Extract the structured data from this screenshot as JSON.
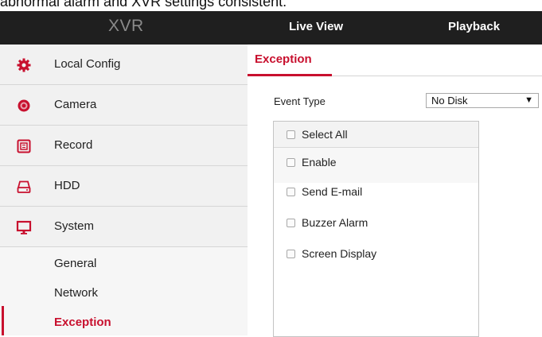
{
  "caption": "abnormal alarm and XVR settings consistent.",
  "header": {
    "logo": "XVR",
    "nav": [
      "Live View",
      "Playback"
    ]
  },
  "sidebar": {
    "items": [
      {
        "label": "Local Config",
        "icon": "gear-icon"
      },
      {
        "label": "Camera",
        "icon": "camera-icon"
      },
      {
        "label": "Record",
        "icon": "record-icon"
      },
      {
        "label": "HDD",
        "icon": "hdd-icon"
      },
      {
        "label": "System",
        "icon": "monitor-icon"
      }
    ],
    "subitems": [
      {
        "label": "General"
      },
      {
        "label": "Network"
      },
      {
        "label": "Exception",
        "active": true
      }
    ]
  },
  "main": {
    "tab": "Exception",
    "event_type_label": "Event Type",
    "event_type_value": "No Disk",
    "select_all": "Select All",
    "options": [
      "Enable",
      "Send E-mail",
      "Buzzer Alarm",
      "Screen Display"
    ]
  },
  "colors": {
    "accent": "#c8102e",
    "topbar": "#1f1f1f",
    "sidebar": "#f1f1f1"
  }
}
